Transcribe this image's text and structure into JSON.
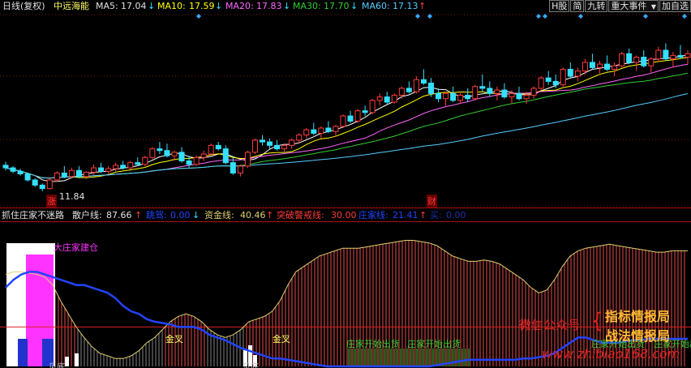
{
  "main": {
    "period": "日线(复权)",
    "stock": "中远海能",
    "ma5_label": "MA5:",
    "ma5": "17.04",
    "ma5_arrow": "↓",
    "ma10_label": "MA10:",
    "ma10": "17.59",
    "ma10_arrow": "↓",
    "ma20_label": "MA20:",
    "ma20": "17.83",
    "ma20_arrow": "↓",
    "ma30_label": "MA30:",
    "ma30": "17.70",
    "ma30_arrow": "↓",
    "ma60_label": "MA60:",
    "ma60": "17.13",
    "ma60_arrow": "↑",
    "low_price": "11.84",
    "zhang_mark": "涨",
    "cai_mark": "财"
  },
  "toolbar": {
    "h_share": "H股",
    "jian": "简",
    "jiu_zhuan": "九转",
    "major_events": "重大事件",
    "dropdown_arrow": "▼",
    "add_watchlist": "加自选"
  },
  "indicator": {
    "name": "抓住庄家不迷路",
    "sanhu_label": "散户线:",
    "sanhu_value": "87.66",
    "sanhu_arrow": "↑",
    "tiaoxing_label": "跳驾:",
    "tiaoxing_value": "0.00",
    "tiaoxing_arrow": "↓",
    "zijin_label": "资金线:",
    "zijin_value": "40.46",
    "zijin_arrow": "↑",
    "tupo_label": "突破警戒线:",
    "tupo_value": "30.00",
    "zhuangjia_label": "庄家线:",
    "zhuangjia_value": "21.41",
    "zhuangjia_arrow": "↑",
    "mai_label": "买:",
    "mai_value": "0.00"
  },
  "annotations": {
    "build": "大庄家建仓",
    "golden_cross_1": "金叉",
    "golden_cross_2": "金叉",
    "start_sell_1": "庄家开始出货",
    "start_sell_2": "庄家开始出货",
    "start_sell_3": "庄家开始出货",
    "start_sell_4": "庄家开始出货",
    "bottom_1": "见底",
    "bottom_2": "见底"
  },
  "watermark": {
    "wechat": "微信公众号",
    "brand1": "指标情报局",
    "brand2": "战法情报局",
    "site": "www.zhibiao168.com"
  },
  "colors": {
    "up": "#ff3b3b",
    "down": "#33e0ff",
    "ma5": "#ffffff",
    "ma10": "#ffff00",
    "ma20": "#ff66ff",
    "ma30": "#33cc33",
    "ma60": "#55ccff",
    "zhuangjia": "#2244ff",
    "zijin": "#e0d070",
    "bars": "#ff5555",
    "pink": "#ff33ff"
  },
  "chart_data": {
    "type": "candlestick",
    "candles": [
      {
        "o": 13.35,
        "h": 13.55,
        "l": 13.05,
        "c": 13.2
      },
      {
        "o": 13.2,
        "h": 13.3,
        "l": 12.9,
        "c": 13.0
      },
      {
        "o": 13.0,
        "h": 13.15,
        "l": 12.75,
        "c": 12.85
      },
      {
        "o": 12.85,
        "h": 12.9,
        "l": 12.4,
        "c": 12.5
      },
      {
        "o": 12.5,
        "h": 12.6,
        "l": 12.1,
        "c": 12.2
      },
      {
        "o": 12.2,
        "h": 12.3,
        "l": 11.84,
        "c": 12.0
      },
      {
        "o": 12.0,
        "h": 12.6,
        "l": 11.95,
        "c": 12.5
      },
      {
        "o": 12.5,
        "h": 13.0,
        "l": 12.4,
        "c": 12.9
      },
      {
        "o": 12.9,
        "h": 13.3,
        "l": 12.6,
        "c": 12.7
      },
      {
        "o": 12.7,
        "h": 13.2,
        "l": 12.6,
        "c": 13.05
      },
      {
        "o": 13.05,
        "h": 13.3,
        "l": 12.6,
        "c": 12.7
      },
      {
        "o": 12.7,
        "h": 13.0,
        "l": 12.55,
        "c": 12.95
      },
      {
        "o": 12.95,
        "h": 13.4,
        "l": 12.8,
        "c": 13.2
      },
      {
        "o": 13.2,
        "h": 13.5,
        "l": 12.9,
        "c": 13.0
      },
      {
        "o": 13.0,
        "h": 13.3,
        "l": 12.85,
        "c": 13.15
      },
      {
        "o": 13.15,
        "h": 13.5,
        "l": 13.0,
        "c": 13.35
      },
      {
        "o": 13.35,
        "h": 13.6,
        "l": 13.1,
        "c": 13.2
      },
      {
        "o": 13.2,
        "h": 13.6,
        "l": 13.1,
        "c": 13.5
      },
      {
        "o": 13.5,
        "h": 13.8,
        "l": 13.3,
        "c": 13.4
      },
      {
        "o": 13.4,
        "h": 13.9,
        "l": 13.3,
        "c": 13.8
      },
      {
        "o": 13.8,
        "h": 14.4,
        "l": 13.7,
        "c": 14.3
      },
      {
        "o": 14.3,
        "h": 14.7,
        "l": 14.0,
        "c": 14.2
      },
      {
        "o": 14.2,
        "h": 14.6,
        "l": 13.8,
        "c": 13.9
      },
      {
        "o": 13.9,
        "h": 14.2,
        "l": 13.6,
        "c": 14.1
      },
      {
        "o": 14.1,
        "h": 14.4,
        "l": 13.5,
        "c": 13.6
      },
      {
        "o": 13.6,
        "h": 13.9,
        "l": 13.2,
        "c": 13.4
      },
      {
        "o": 13.4,
        "h": 13.9,
        "l": 13.3,
        "c": 13.8
      },
      {
        "o": 13.8,
        "h": 14.2,
        "l": 13.6,
        "c": 14.0
      },
      {
        "o": 14.0,
        "h": 14.6,
        "l": 13.9,
        "c": 14.5
      },
      {
        "o": 14.5,
        "h": 14.7,
        "l": 14.2,
        "c": 14.3
      },
      {
        "o": 14.3,
        "h": 14.5,
        "l": 13.4,
        "c": 13.5
      },
      {
        "o": 13.5,
        "h": 13.8,
        "l": 12.8,
        "c": 12.9
      },
      {
        "o": 12.9,
        "h": 13.4,
        "l": 12.7,
        "c": 13.3
      },
      {
        "o": 13.3,
        "h": 14.2,
        "l": 13.2,
        "c": 14.1
      },
      {
        "o": 14.1,
        "h": 14.9,
        "l": 14.0,
        "c": 14.8
      },
      {
        "o": 14.8,
        "h": 15.1,
        "l": 14.5,
        "c": 14.7
      },
      {
        "o": 14.7,
        "h": 14.9,
        "l": 14.3,
        "c": 14.5
      },
      {
        "o": 14.5,
        "h": 14.8,
        "l": 14.2,
        "c": 14.3
      },
      {
        "o": 14.3,
        "h": 14.6,
        "l": 14.1,
        "c": 14.5
      },
      {
        "o": 14.5,
        "h": 14.9,
        "l": 14.3,
        "c": 14.8
      },
      {
        "o": 14.8,
        "h": 15.2,
        "l": 14.6,
        "c": 15.1
      },
      {
        "o": 15.1,
        "h": 15.5,
        "l": 14.9,
        "c": 15.4
      },
      {
        "o": 15.4,
        "h": 15.8,
        "l": 15.1,
        "c": 15.2
      },
      {
        "o": 15.2,
        "h": 15.6,
        "l": 14.9,
        "c": 15.5
      },
      {
        "o": 15.5,
        "h": 15.9,
        "l": 15.2,
        "c": 15.3
      },
      {
        "o": 15.3,
        "h": 15.7,
        "l": 15.0,
        "c": 15.6
      },
      {
        "o": 15.6,
        "h": 16.3,
        "l": 15.5,
        "c": 16.2
      },
      {
        "o": 16.2,
        "h": 16.5,
        "l": 15.8,
        "c": 15.9
      },
      {
        "o": 15.9,
        "h": 16.6,
        "l": 15.8,
        "c": 16.5
      },
      {
        "o": 16.5,
        "h": 16.8,
        "l": 16.2,
        "c": 16.4
      },
      {
        "o": 16.4,
        "h": 17.2,
        "l": 16.3,
        "c": 17.1
      },
      {
        "o": 17.1,
        "h": 17.5,
        "l": 16.8,
        "c": 17.3
      },
      {
        "o": 17.3,
        "h": 17.6,
        "l": 16.9,
        "c": 17.0
      },
      {
        "o": 17.0,
        "h": 17.5,
        "l": 16.9,
        "c": 17.4
      },
      {
        "o": 17.4,
        "h": 17.9,
        "l": 17.2,
        "c": 17.8
      },
      {
        "o": 17.8,
        "h": 18.2,
        "l": 17.5,
        "c": 17.6
      },
      {
        "o": 17.6,
        "h": 18.5,
        "l": 17.5,
        "c": 18.3
      },
      {
        "o": 18.3,
        "h": 18.9,
        "l": 18.0,
        "c": 18.1
      },
      {
        "o": 18.1,
        "h": 18.4,
        "l": 17.3,
        "c": 17.5
      },
      {
        "o": 17.5,
        "h": 17.8,
        "l": 17.0,
        "c": 17.2
      },
      {
        "o": 17.2,
        "h": 17.6,
        "l": 16.8,
        "c": 17.5
      },
      {
        "o": 17.5,
        "h": 17.9,
        "l": 17.0,
        "c": 17.1
      },
      {
        "o": 17.1,
        "h": 17.6,
        "l": 16.9,
        "c": 17.4
      },
      {
        "o": 17.4,
        "h": 17.8,
        "l": 17.0,
        "c": 17.2
      },
      {
        "o": 17.2,
        "h": 18.0,
        "l": 17.1,
        "c": 17.9
      },
      {
        "o": 17.9,
        "h": 18.6,
        "l": 17.6,
        "c": 17.8
      },
      {
        "o": 17.8,
        "h": 18.2,
        "l": 17.3,
        "c": 17.5
      },
      {
        "o": 17.5,
        "h": 17.9,
        "l": 17.1,
        "c": 17.7
      },
      {
        "o": 17.7,
        "h": 18.1,
        "l": 17.2,
        "c": 17.3
      },
      {
        "o": 17.3,
        "h": 17.7,
        "l": 16.9,
        "c": 17.5
      },
      {
        "o": 17.5,
        "h": 17.9,
        "l": 17.1,
        "c": 17.2
      },
      {
        "o": 17.2,
        "h": 17.6,
        "l": 16.9,
        "c": 17.4
      },
      {
        "o": 17.4,
        "h": 17.9,
        "l": 17.2,
        "c": 17.8
      },
      {
        "o": 17.8,
        "h": 18.5,
        "l": 17.7,
        "c": 18.4
      },
      {
        "o": 18.4,
        "h": 18.8,
        "l": 18.0,
        "c": 18.2
      },
      {
        "o": 18.2,
        "h": 18.6,
        "l": 17.8,
        "c": 18.0
      },
      {
        "o": 18.0,
        "h": 19.0,
        "l": 17.9,
        "c": 18.9
      },
      {
        "o": 18.9,
        "h": 19.3,
        "l": 18.4,
        "c": 18.5
      },
      {
        "o": 18.5,
        "h": 19.0,
        "l": 18.2,
        "c": 18.8
      },
      {
        "o": 18.8,
        "h": 19.5,
        "l": 18.6,
        "c": 19.3
      },
      {
        "o": 19.3,
        "h": 19.8,
        "l": 18.9,
        "c": 19.0
      },
      {
        "o": 19.0,
        "h": 19.4,
        "l": 18.6,
        "c": 19.2
      },
      {
        "o": 19.2,
        "h": 19.7,
        "l": 18.8,
        "c": 18.9
      },
      {
        "o": 18.9,
        "h": 19.3,
        "l": 18.5,
        "c": 19.1
      },
      {
        "o": 19.1,
        "h": 19.9,
        "l": 19.0,
        "c": 19.8
      },
      {
        "o": 19.8,
        "h": 20.1,
        "l": 19.2,
        "c": 19.3
      },
      {
        "o": 19.3,
        "h": 19.7,
        "l": 18.8,
        "c": 19.6
      },
      {
        "o": 19.6,
        "h": 20.0,
        "l": 19.0,
        "c": 19.1
      },
      {
        "o": 19.1,
        "h": 19.6,
        "l": 18.7,
        "c": 19.5
      },
      {
        "o": 19.5,
        "h": 20.2,
        "l": 19.3,
        "c": 20.0
      },
      {
        "o": 20.0,
        "h": 20.4,
        "l": 19.4,
        "c": 19.5
      },
      {
        "o": 19.5,
        "h": 19.9,
        "l": 19.0,
        "c": 19.7
      },
      {
        "o": 19.7,
        "h": 20.3,
        "l": 19.5,
        "c": 19.6
      },
      {
        "o": 19.6,
        "h": 20.0,
        "l": 19.2,
        "c": 19.8
      }
    ],
    "ylim": [
      11.0,
      21.5
    ],
    "indicator": {
      "zijin": [
        70,
        72,
        72,
        71,
        70,
        68,
        62,
        50,
        40,
        30,
        22,
        15,
        10,
        8,
        6,
        6,
        8,
        12,
        18,
        22,
        28,
        34,
        38,
        40,
        38,
        34,
        28,
        24,
        22,
        24,
        28,
        34,
        36,
        38,
        42,
        50,
        62,
        72,
        76,
        80,
        84,
        86,
        88,
        90,
        90,
        90,
        91,
        92,
        93,
        94,
        95,
        96,
        96,
        95,
        94,
        92,
        88,
        84,
        82,
        80,
        80,
        81,
        80,
        78,
        74,
        70,
        66,
        60,
        56,
        58,
        66,
        76,
        84,
        88,
        90,
        91,
        92,
        93,
        92,
        91,
        90,
        89,
        88,
        87,
        87,
        88,
        88,
        88
      ],
      "zhuangjia": [
        60,
        66,
        70,
        72,
        72,
        70,
        68,
        66,
        64,
        62,
        62,
        60,
        58,
        56,
        52,
        46,
        42,
        40,
        36,
        34,
        33,
        32,
        30,
        30,
        30,
        28,
        24,
        22,
        20,
        17,
        14,
        12,
        10,
        8,
        6,
        6,
        5,
        4,
        3,
        2,
        1,
        0,
        0,
        0,
        0,
        0,
        0,
        0,
        0,
        0,
        0,
        0,
        0,
        0,
        0,
        1,
        2,
        3,
        4,
        5,
        5,
        5,
        5,
        5,
        5,
        5,
        6,
        6,
        7,
        8,
        10,
        14,
        18,
        22,
        22,
        20,
        18,
        18,
        18,
        19,
        20,
        20,
        21,
        21,
        21,
        21,
        21,
        21
      ],
      "threshold": 30
    }
  }
}
